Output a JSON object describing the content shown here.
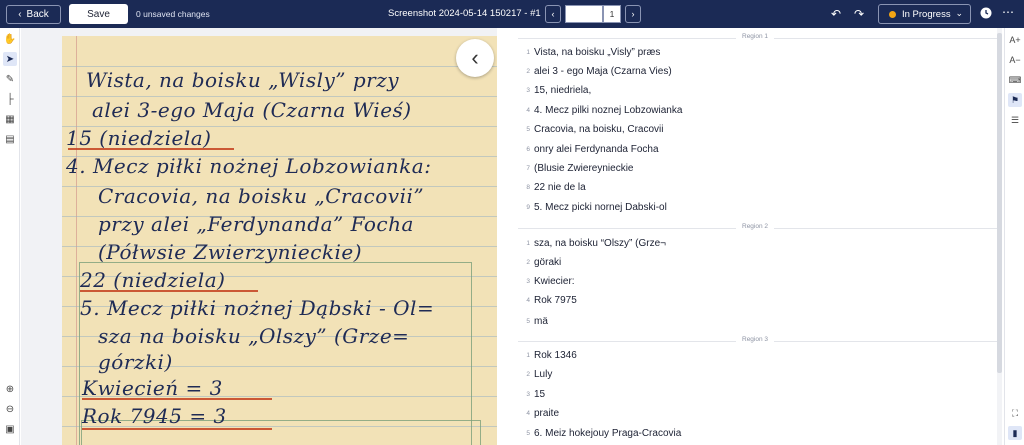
{
  "header": {
    "back_label": "Back",
    "save_label": "Save",
    "unsaved_text": "0 unsaved changes",
    "document_title": "Screenshot 2024-05-14 150217 - #1",
    "page_number": "1",
    "status_label": "In Progress",
    "status_color": "#f3a514"
  },
  "icons": {
    "back": "chevron-left-icon",
    "prev_page": "chevron-left-icon",
    "next_page": "chevron-right-icon",
    "undo": "undo-icon",
    "redo": "redo-icon",
    "clock": "clock-icon",
    "more": "more-horizontal-icon",
    "collapse": "chevron-left-icon"
  },
  "image": {
    "handwriting": [
      "Wista, na boisku „Wisly” przy",
      "alei 3-ego Maja (Czarna Wieś)",
      "15 (niedziela)",
      "4. Mecz piłki nożnej Lobzowianka:",
      "Cracovia, na boisku „Cracovii”",
      "przy alei „Ferdynanda” Focha",
      "(Półwsie Zwierzynieckie)",
      "22 (niedziela)",
      "5. Mecz piłki nożnej Dąbski - Ol=",
      "sza na boisku „Olszy” (Grze=",
      "górzki)",
      "Kwiecień = 3",
      "Rok 7945 = 3"
    ]
  },
  "transcription": {
    "regions": [
      {
        "label": "Region 1",
        "lines": [
          "Vista, na boisku „Visly” præs",
          "alei 3 - ego Maja (Czarna Vies)",
          "15, niedriela,",
          "4. Mecz pilki noznej Lobzowianka",
          "Cracovia, na boisku, Cracovii",
          "onry alei Ferdynanda Focha",
          "(Blusie Zwiereynieckie",
          "22 nie de la",
          "5. Mecz picki nornej Dabski-ol"
        ]
      },
      {
        "label": "Region 2",
        "lines": [
          "sza, na boisku “Olszy” (Grze¬",
          "göraki",
          "Kwiecier:",
          "Rok 7975",
          "mä"
        ]
      },
      {
        "label": "Region 3",
        "lines": [
          "Rok 1346",
          "Luly",
          "15",
          "praite",
          "6. Meiz hokejouy Praga-Cracovia"
        ]
      }
    ]
  },
  "right_toolbar": {
    "font_increase": "A+",
    "font_decrease": "A−"
  }
}
